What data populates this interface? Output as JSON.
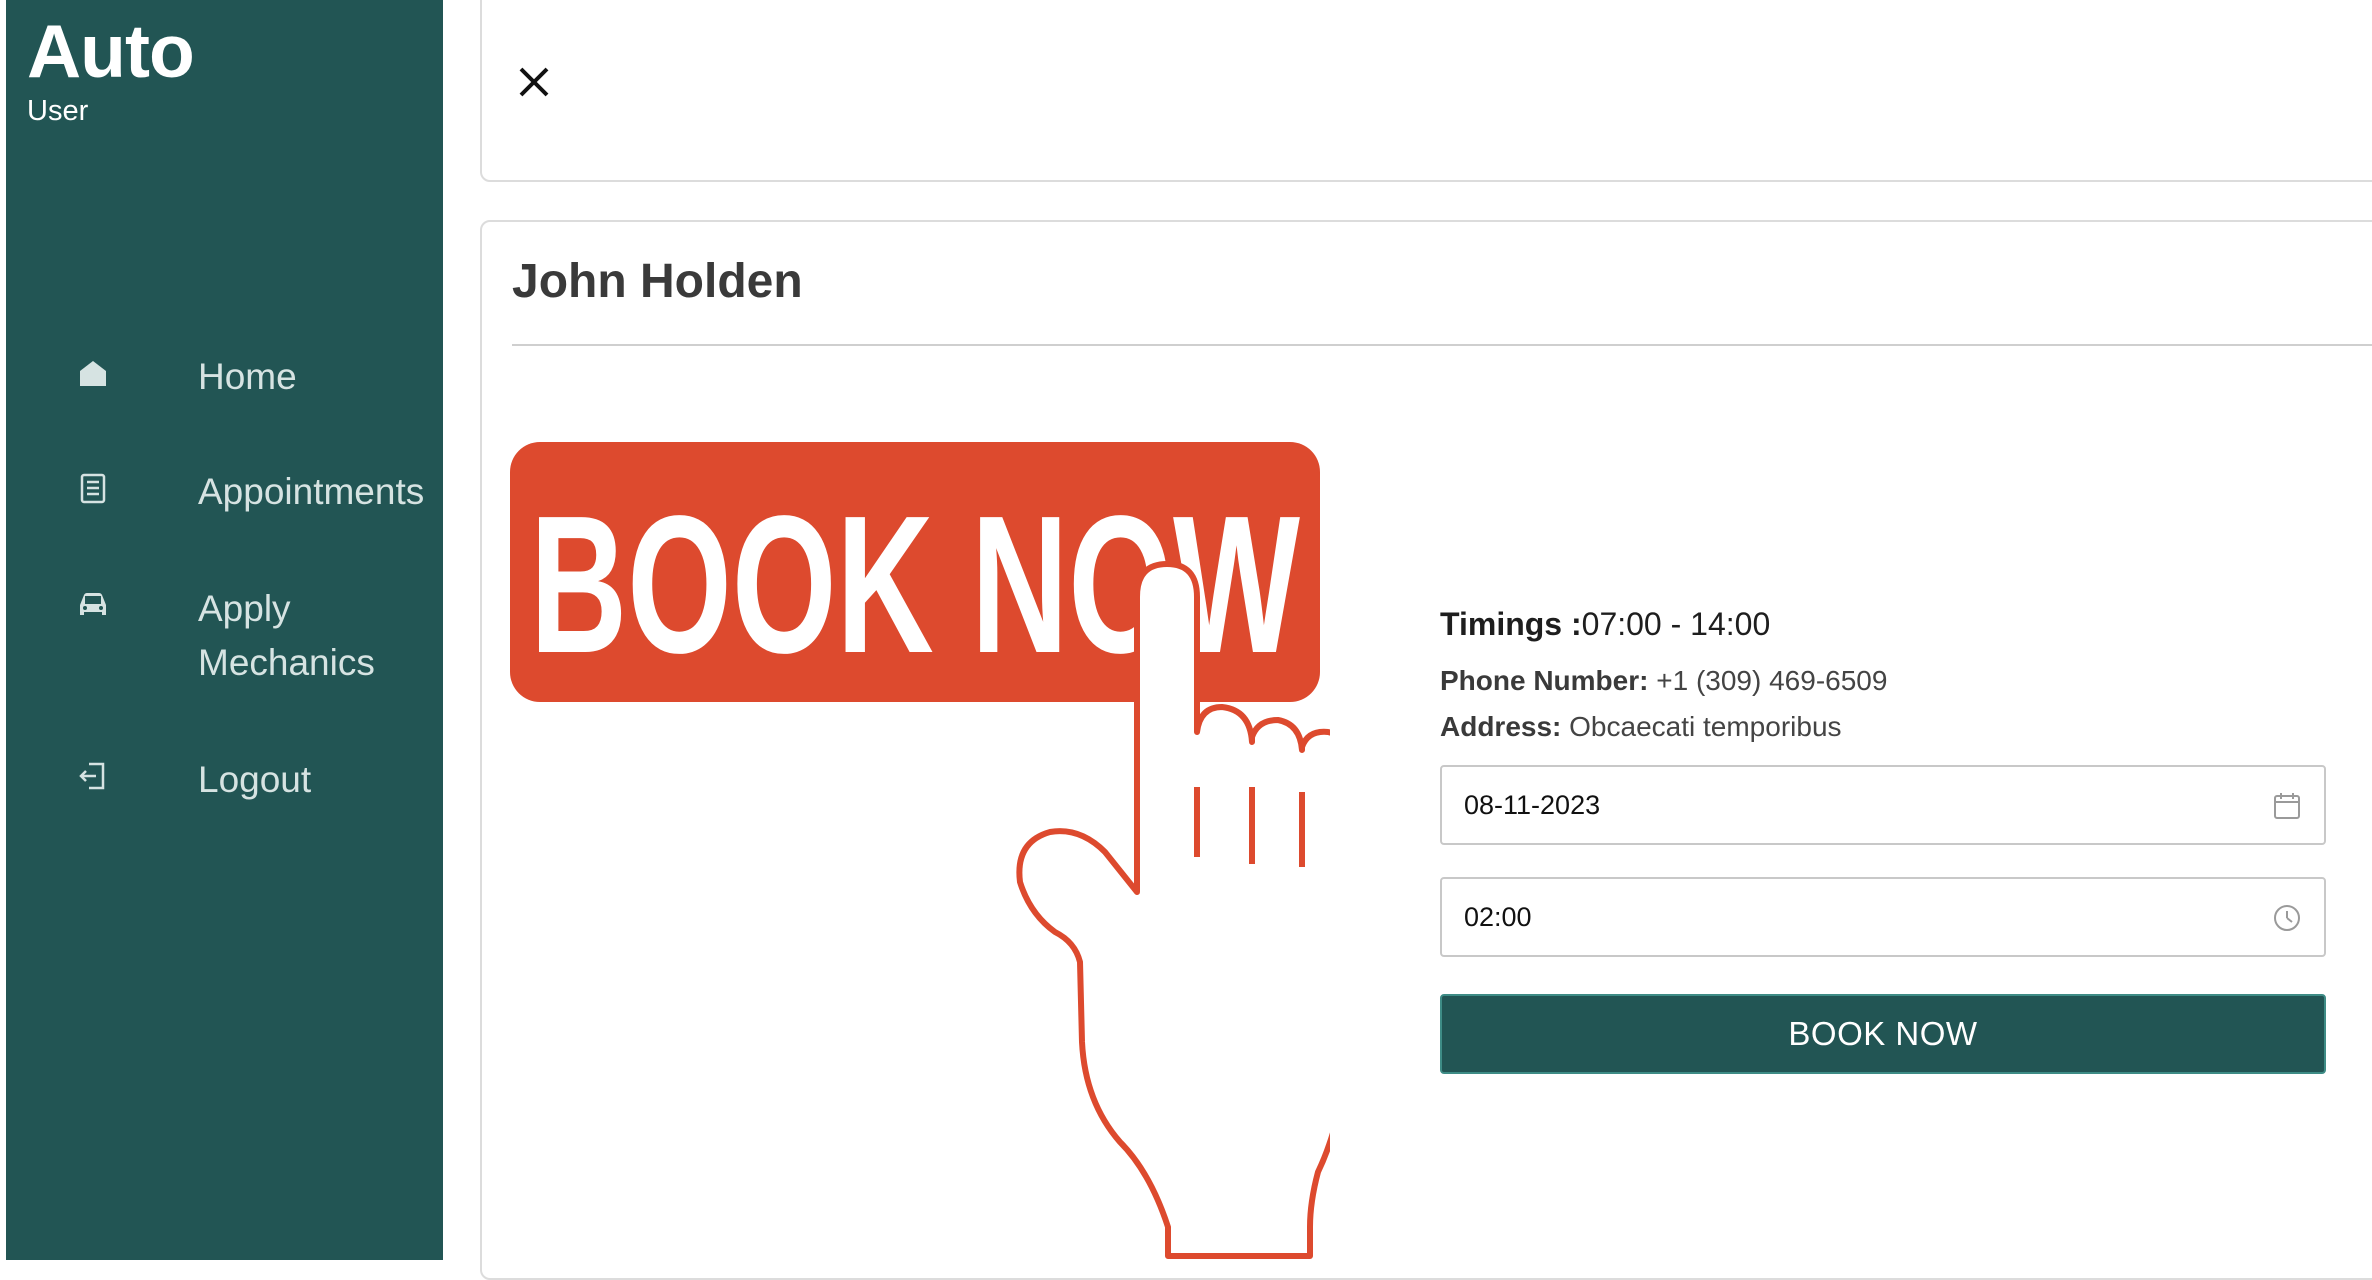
{
  "sidebar": {
    "brand_title": "Auto",
    "brand_subtitle": "User",
    "items": [
      {
        "label": "Home",
        "icon": "home-icon"
      },
      {
        "label": "Appointments",
        "icon": "list-icon"
      },
      {
        "label": "Apply Mechanics",
        "icon": "car-icon"
      },
      {
        "label": "Logout",
        "icon": "logout-icon"
      }
    ]
  },
  "header": {
    "close_icon": "close-icon"
  },
  "mechanic": {
    "name": "John Holden",
    "timings_label": "Timings :",
    "timings_value": "07:00 - 14:00",
    "phone_label": "Phone Number:",
    "phone_value": "+1 (309) 469-6509",
    "address_label": "Address:",
    "address_value": "Obcaecati temporibus"
  },
  "booking": {
    "graphic_text": "BOOK NOW",
    "date_value": "08-11-2023",
    "time_value": "02:00",
    "button_label": "BOOK NOW"
  },
  "colors": {
    "sidebar": "#225554",
    "accent_orange": "#DD4A2E"
  }
}
